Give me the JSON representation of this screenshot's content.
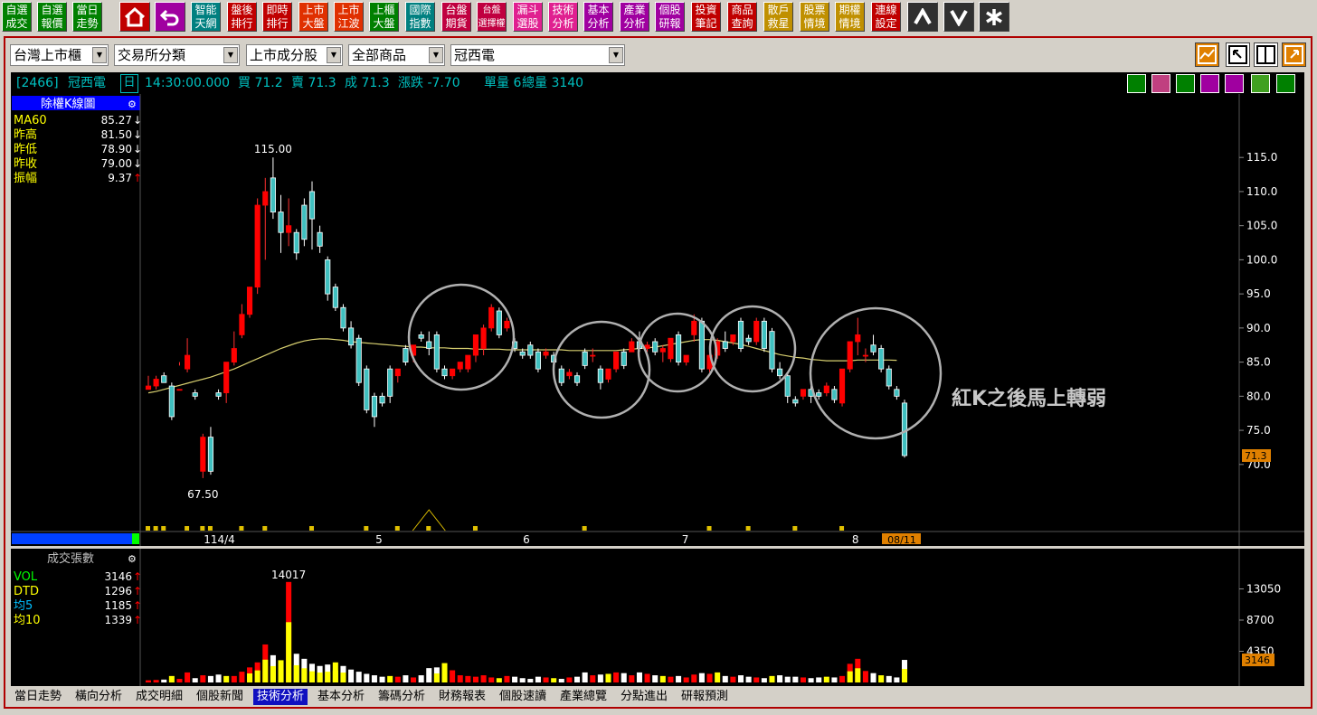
{
  "toolbar": {
    "buttons": [
      {
        "label": "自選\n成交",
        "color": "#008000"
      },
      {
        "label": "自選\n報價",
        "color": "#008000"
      },
      {
        "label": "當日\n走勢",
        "color": "#008000"
      },
      {
        "label": "智能\n天網",
        "color": "#008080"
      },
      {
        "label": "盤後\n排行",
        "color": "#c00000"
      },
      {
        "label": "即時\n排行",
        "color": "#c00000"
      },
      {
        "label": "上市\n大盤",
        "color": "#e03000"
      },
      {
        "label": "上市\n江波",
        "color": "#e03000"
      },
      {
        "label": "上櫃\n大盤",
        "color": "#008000"
      },
      {
        "label": "國際\n指數",
        "color": "#008080"
      },
      {
        "label": "台盤\n期貨",
        "color": "#c00040"
      },
      {
        "label": "台盤\n選擇權",
        "color": "#c00040"
      },
      {
        "label": "漏斗\n選股",
        "color": "#e02090"
      },
      {
        "label": "技術\n分析",
        "color": "#e02090"
      },
      {
        "label": "基本\n分析",
        "color": "#a000a0"
      },
      {
        "label": "產業\n分析",
        "color": "#a000a0"
      },
      {
        "label": "個股\n研報",
        "color": "#a000a0"
      },
      {
        "label": "投資\n筆記",
        "color": "#c00000"
      },
      {
        "label": "商品\n查詢",
        "color": "#c00000"
      },
      {
        "label": "散戶\n救星",
        "color": "#c09000"
      },
      {
        "label": "股票\n情境",
        "color": "#c09000"
      },
      {
        "label": "期權\n情境",
        "color": "#c09000"
      },
      {
        "label": "連線\n設定",
        "color": "#c00000"
      }
    ]
  },
  "selectors": {
    "market": "台灣上市櫃",
    "category": "交易所分類",
    "list": "上市成分股",
    "product": "全部商品",
    "stock": "冠西電"
  },
  "quote": {
    "code": "[2466]",
    "name": "冠西電",
    "period_icon": "日",
    "time": "14:30:00.000",
    "bid": "買 71.2",
    "ask": "賣 71.3",
    "last": "成 71.3",
    "change": "漲跌 -7.70",
    "single_vol": "單量 6",
    "total_vol": "總量 3140"
  },
  "main_panel": {
    "title": "除權K線圖",
    "stats": [
      {
        "label": "MA60",
        "value": "85.27",
        "arrow": "↓",
        "label_color": "#ffff00",
        "arrow_color": "#ffffff"
      },
      {
        "label": "昨高",
        "value": "81.50",
        "arrow": "↓",
        "label_color": "#ffff00",
        "arrow_color": "#ffffff"
      },
      {
        "label": "昨低",
        "value": "78.90",
        "arrow": "↓",
        "label_color": "#ffff00",
        "arrow_color": "#ffffff"
      },
      {
        "label": "昨收",
        "value": "79.00",
        "arrow": "↓",
        "label_color": "#ffff00",
        "arrow_color": "#ffffff"
      },
      {
        "label": "振幅",
        "value": "9.37",
        "arrow": "↑",
        "label_color": "#ffff00",
        "arrow_color": "#ff0000"
      }
    ],
    "price_ticks": [
      "115.0",
      "110.0",
      "105.0",
      "100.0",
      "95.0",
      "90.0",
      "85.0",
      "80.0",
      "75.0",
      "70.0"
    ],
    "current_price": "71.3",
    "high_label": "115.00",
    "low_label": "67.50",
    "date_labels": [
      "114/4",
      "5",
      "6",
      "7",
      "8"
    ],
    "current_date": "08/11",
    "annotation": "紅K之後馬上轉弱"
  },
  "volume_panel": {
    "title": "成交張數",
    "stats": [
      {
        "label": "VOL",
        "value": "3146",
        "arrow": "↑",
        "label_color": "#00ff00",
        "arrow_color": "#ff0000"
      },
      {
        "label": "DTD",
        "value": "1296",
        "arrow": "↑",
        "label_color": "#ffff00",
        "arrow_color": "#ff0000"
      },
      {
        "label": "均5",
        "value": "1185",
        "arrow": "↑",
        "label_color": "#00c0ff",
        "arrow_color": "#ff0000"
      },
      {
        "label": "均10",
        "value": "1339",
        "arrow": "↑",
        "label_color": "#ffff00",
        "arrow_color": "#ff0000"
      }
    ],
    "ticks": [
      "13050",
      "8700",
      "4350"
    ],
    "current_vol": "3146",
    "peak_label": "14017"
  },
  "tabs": [
    "當日走勢",
    "橫向分析",
    "成交明細",
    "個股新聞",
    "技術分析",
    "基本分析",
    "籌碼分析",
    "財務報表",
    "個股速讀",
    "產業總覽",
    "分點進出",
    "研報預測"
  ],
  "active_tab": "技術分析",
  "chart_data": {
    "type": "candlestick",
    "title": "除權K線圖",
    "ylim": [
      66,
      119
    ],
    "x_labels": [
      "114/4",
      "5",
      "6",
      "7",
      "8"
    ],
    "candles": [
      [
        81.0,
        83.0,
        81.5,
        81.0
      ],
      [
        81.5,
        83.0,
        82.5,
        81.0
      ],
      [
        83.0,
        83.5,
        82.0,
        82.0
      ],
      [
        81.5,
        82.0,
        77.0,
        76.5
      ],
      [
        81.0,
        85.0,
        81.0,
        84.5
      ],
      [
        84.0,
        88.5,
        86.0,
        83.5
      ],
      [
        80.5,
        81.0,
        80.0,
        79.5
      ],
      [
        69.0,
        74.5,
        74.0,
        68.0
      ],
      [
        74.0,
        75.5,
        69.0,
        68.5
      ],
      [
        80.5,
        81.0,
        80.0,
        79.5
      ],
      [
        80.5,
        84.5,
        85.0,
        79.0
      ],
      [
        85.0,
        89.5,
        87.0,
        84.5
      ],
      [
        89.0,
        93.5,
        92.0,
        88.5
      ],
      [
        92.0,
        96.0,
        96.0,
        91.5
      ],
      [
        96.0,
        109.0,
        108.0,
        95.0
      ],
      [
        108.0,
        112.0,
        110.0,
        100.0
      ],
      [
        112.0,
        115.0,
        107.0,
        106.0
      ],
      [
        107.0,
        109.5,
        104.0,
        101.0
      ],
      [
        104.0,
        109.0,
        105.0,
        102.0
      ],
      [
        104.0,
        104.5,
        101.0,
        100.0
      ],
      [
        108.0,
        109.0,
        103.0,
        102.0
      ],
      [
        110.0,
        111.5,
        106.0,
        101.5
      ],
      [
        104.0,
        105.0,
        102.0,
        101.0
      ],
      [
        100.0,
        100.5,
        95.0,
        94.0
      ],
      [
        96.0,
        96.5,
        93.0,
        92.5
      ],
      [
        93.0,
        93.5,
        90.0,
        89.5
      ],
      [
        90.0,
        91.0,
        87.5,
        87.0
      ],
      [
        88.5,
        89.0,
        82.0,
        81.5
      ],
      [
        84.0,
        84.5,
        78.0,
        77.5
      ],
      [
        80.0,
        80.5,
        77.0,
        75.5
      ],
      [
        80.0,
        80.5,
        79.0,
        78.5
      ],
      [
        84.0,
        84.5,
        80.0,
        79.0
      ],
      [
        83.0,
        84.0,
        84.0,
        82.0
      ],
      [
        87.0,
        87.5,
        85.0,
        84.5
      ],
      [
        86.0,
        87.0,
        87.5,
        85.0
      ],
      [
        89.0,
        89.5,
        88.5,
        88.0
      ],
      [
        88.0,
        89.5,
        87.0,
        86.0
      ],
      [
        89.0,
        89.5,
        84.0,
        83.5
      ],
      [
        84.0,
        84.5,
        83.0,
        82.5
      ],
      [
        83.0,
        84.0,
        84.0,
        82.5
      ],
      [
        84.0,
        85.0,
        85.0,
        83.5
      ],
      [
        84.0,
        85.0,
        86.0,
        83.5
      ],
      [
        86.0,
        87.5,
        89.0,
        85.0
      ],
      [
        87.0,
        90.5,
        90.0,
        86.0
      ],
      [
        90.0,
        93.5,
        93.0,
        89.5
      ],
      [
        92.5,
        93.0,
        89.0,
        88.5
      ],
      [
        90.0,
        91.5,
        91.0,
        89.5
      ],
      [
        88.0,
        88.5,
        87.0,
        86.5
      ],
      [
        86.5,
        87.0,
        86.0,
        85.5
      ],
      [
        87.5,
        88.0,
        86.0,
        85.5
      ],
      [
        86.5,
        87.0,
        84.0,
        83.5
      ],
      [
        86.0,
        87.0,
        86.5,
        85.5
      ],
      [
        86.0,
        86.5,
        85.0,
        84.5
      ],
      [
        84.0,
        84.5,
        82.0,
        81.5
      ],
      [
        83.0,
        84.0,
        83.5,
        82.5
      ],
      [
        83.0,
        83.5,
        82.0,
        81.5
      ],
      [
        86.5,
        87.0,
        84.5,
        84.0
      ],
      [
        86.0,
        87.0,
        86.0,
        85.0
      ],
      [
        84.0,
        84.5,
        82.0,
        81.0
      ],
      [
        82.5,
        83.0,
        84.0,
        82.0
      ],
      [
        84.0,
        85.0,
        86.5,
        83.5
      ],
      [
        86.5,
        87.0,
        84.5,
        84.0
      ],
      [
        86.5,
        88.5,
        88.0,
        86.5
      ],
      [
        88.0,
        89.5,
        87.0,
        86.5
      ],
      [
        87.0,
        88.0,
        87.5,
        86.5
      ],
      [
        88.0,
        88.5,
        86.5,
        86.0
      ],
      [
        86.5,
        87.5,
        87.0,
        85.0
      ],
      [
        85.5,
        88.5,
        88.5,
        85.0
      ],
      [
        89.0,
        89.5,
        85.0,
        84.5
      ],
      [
        85.0,
        85.5,
        86.0,
        84.5
      ],
      [
        89.0,
        92.0,
        91.0,
        88.0
      ],
      [
        91.0,
        91.5,
        84.0,
        83.5
      ],
      [
        84.0,
        86.5,
        86.0,
        83.5
      ],
      [
        86.0,
        88.5,
        88.0,
        85.5
      ],
      [
        88.0,
        89.5,
        87.0,
        86.5
      ],
      [
        88.0,
        89.0,
        89.0,
        87.5
      ],
      [
        91.0,
        91.5,
        87.0,
        86.5
      ],
      [
        88.5,
        89.0,
        88.0,
        87.5
      ],
      [
        88.0,
        91.5,
        91.0,
        87.5
      ],
      [
        91.0,
        91.5,
        87.0,
        86.5
      ],
      [
        89.5,
        90.0,
        84.0,
        83.5
      ],
      [
        84.0,
        85.0,
        83.0,
        82.5
      ],
      [
        83.0,
        83.5,
        80.0,
        79.0
      ],
      [
        79.5,
        80.0,
        79.0,
        78.5
      ],
      [
        80.0,
        81.0,
        81.0,
        79.5
      ],
      [
        81.0,
        81.5,
        80.0,
        79.0
      ],
      [
        80.5,
        81.0,
        80.0,
        79.5
      ],
      [
        80.5,
        82.0,
        81.5,
        80.0
      ],
      [
        81.0,
        81.5,
        79.5,
        79.0
      ],
      [
        79.0,
        79.5,
        84.0,
        78.5
      ],
      [
        84.0,
        88.0,
        88.0,
        83.5
      ],
      [
        88.0,
        91.5,
        89.0,
        86.0
      ],
      [
        86.0,
        87.0,
        86.0,
        85.0
      ],
      [
        87.5,
        89.0,
        86.5,
        86.0
      ],
      [
        87.0,
        87.5,
        84.0,
        83.5
      ],
      [
        84.0,
        84.5,
        81.5,
        81.0
      ],
      [
        81.0,
        81.5,
        80.0,
        79.5
      ],
      [
        79.0,
        79.5,
        71.3,
        71.0
      ]
    ],
    "ma60": [
      80.5,
      80.7,
      81.0,
      81.3,
      81.6,
      81.9,
      82.2,
      82.5,
      82.8,
      83.2,
      83.6,
      84.0,
      84.5,
      85.0,
      85.5,
      86.0,
      86.5,
      87.0,
      87.4,
      87.8,
      88.1,
      88.3,
      88.4,
      88.4,
      88.3,
      88.2,
      88.0,
      87.9,
      87.8,
      87.7,
      87.6,
      87.5,
      87.4,
      87.3,
      87.2,
      87.2,
      87.1,
      87.1,
      87.1,
      87.0,
      87.0,
      87.0,
      86.9,
      86.9,
      86.9,
      86.9,
      86.8,
      86.8,
      86.8,
      86.8,
      86.8,
      86.8,
      86.8,
      86.8,
      86.7,
      86.7,
      86.7,
      86.7,
      86.7,
      86.7,
      86.7,
      86.8,
      86.9,
      87.0,
      87.1,
      87.2,
      87.4,
      87.6,
      87.8,
      88.0,
      88.2,
      88.3,
      88.3,
      88.2,
      88.0,
      87.8,
      87.6,
      87.3,
      87.0,
      86.7,
      86.4,
      86.1,
      85.9,
      85.7,
      85.6,
      85.4,
      85.3,
      85.2,
      85.2,
      85.2,
      85.2,
      85.3,
      85.3,
      85.3,
      85.3,
      85.3,
      85.27
    ],
    "volume": [
      300,
      350,
      400,
      900,
      500,
      1400,
      600,
      1000,
      900,
      1100,
      900,
      900,
      1500,
      2100,
      2800,
      5300,
      3800,
      3100,
      14017,
      4000,
      3300,
      2600,
      2300,
      2500,
      2800,
      2300,
      1800,
      1500,
      1200,
      1000,
      800,
      900,
      800,
      1000,
      700,
      1000,
      2000,
      2100,
      2700,
      1700,
      1000,
      900,
      800,
      1000,
      700,
      600,
      900,
      800,
      600,
      500,
      800,
      700,
      600,
      500,
      700,
      800,
      1400,
      1000,
      1100,
      1200,
      1400,
      1300,
      1000,
      1400,
      1200,
      1000,
      900,
      800,
      900,
      700,
      1100,
      1300,
      1200,
      1400,
      900,
      800,
      1000,
      800,
      700,
      600,
      900,
      1000,
      800,
      800,
      700,
      600,
      700,
      800,
      700,
      900,
      2600,
      3300,
      1600,
      1300,
      1000,
      900,
      700,
      3146
    ]
  }
}
